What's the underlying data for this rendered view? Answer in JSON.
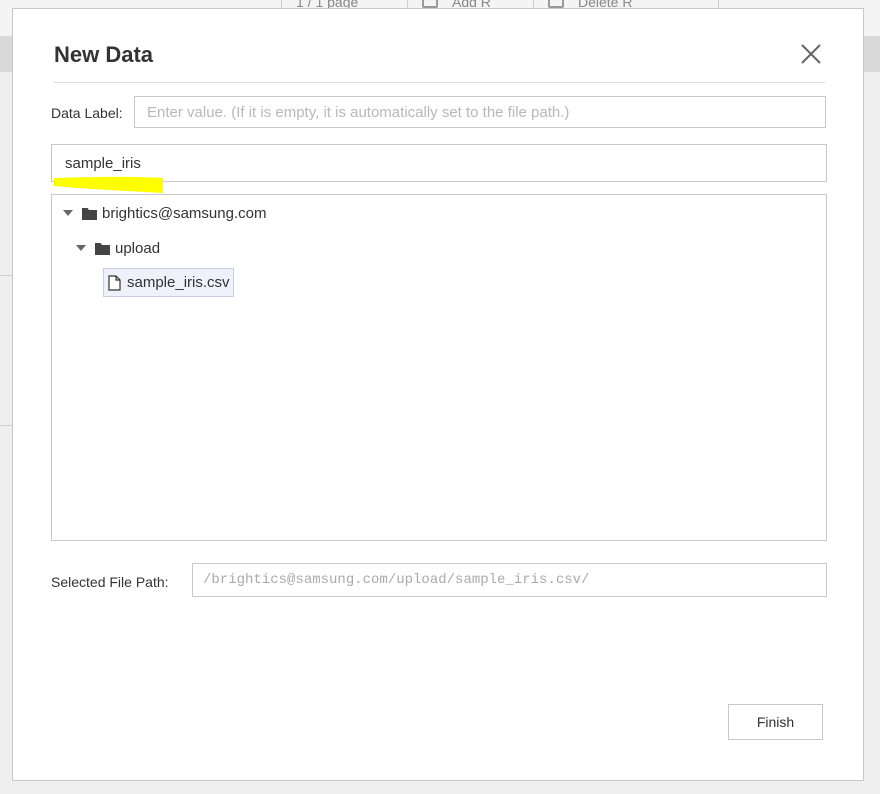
{
  "background": {
    "toolbar_items": [
      "1 / 1 page",
      "Add R",
      "Delete R"
    ]
  },
  "dialog": {
    "title": "New Data",
    "close_icon": "close-icon",
    "data_label": {
      "label": "Data Label:",
      "value": "",
      "placeholder": "Enter value. (If it is empty, it is automatically set to the file path.)"
    },
    "search": {
      "value": "sample_iris",
      "highlight_color": "#ffff00"
    },
    "tree": {
      "root": {
        "label": "brightics@samsung.com",
        "icon": "folder-icon",
        "expanded": true
      },
      "folder": {
        "label": "upload",
        "icon": "folder-icon",
        "expanded": true
      },
      "file": {
        "label": "sample_iris.csv",
        "icon": "file-icon",
        "selected": true
      }
    },
    "selected_path": {
      "label": "Selected File Path:",
      "value": "/brightics@samsung.com/upload/sample_iris.csv/"
    },
    "finish_label": "Finish"
  }
}
